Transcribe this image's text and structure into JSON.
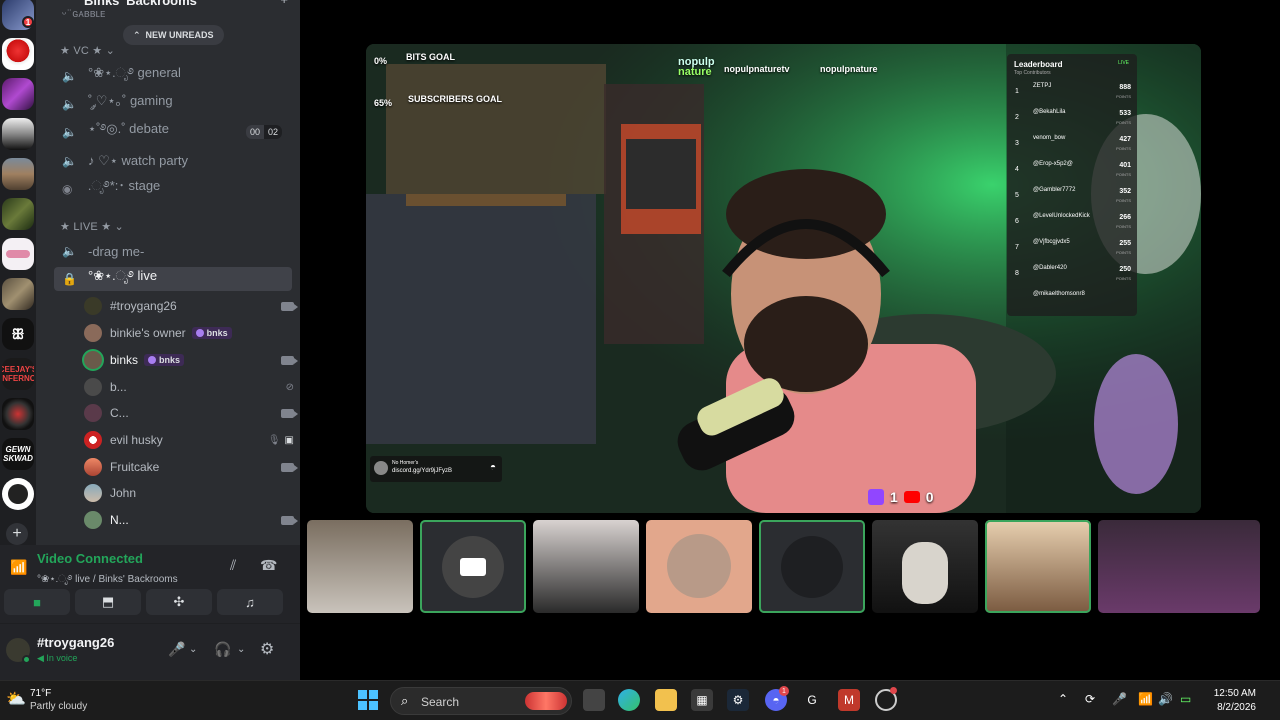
{
  "rail": {
    "badge_top": "1",
    "servers": [
      "DY",
      "",
      "",
      "",
      "",
      "",
      "",
      "",
      "",
      "",
      "CEEJAY'S INFERNO",
      "",
      "GEWN SKWAD",
      "",
      ""
    ]
  },
  "sidebar": {
    "server_name": "Binks' Backrooms",
    "partial_channel": "ᵕ ̈ ɢᴀʙʙʟᴇ",
    "new_unreads": "NEW UNREADS",
    "categories": {
      "vc": "★ VC ★",
      "live": "★ LIVE ★"
    },
    "channels": [
      {
        "name": "°❀⋆.ೃ࿔ general",
        "icon": "speaker-icon"
      },
      {
        "name": "˚ ༘♡⋆｡˚ gaming",
        "icon": "speaker-icon"
      },
      {
        "name": "⋆˚࿔◎.˚ debate",
        "icon": "speaker-icon",
        "count_a": "00",
        "count_b": "02"
      },
      {
        "name": "♪ ♡⋆ watch party",
        "icon": "speaker-icon"
      },
      {
        "name": ".ೃ࿔*:･ stage",
        "icon": "stage-icon"
      },
      {
        "name": "-drag me-",
        "icon": "speaker-icon"
      },
      {
        "name": "°❀⋆.ೃ࿔ live",
        "icon": "lock-speaker-icon"
      }
    ],
    "voice_users": [
      {
        "name": "#troygang26",
        "tag": "",
        "camera": true
      },
      {
        "name": "binkie's owner",
        "tag": "bnks",
        "camera": false
      },
      {
        "name": "binks",
        "tag": "bnks",
        "camera": true
      },
      {
        "name": "b...",
        "tag": "",
        "camera": false
      },
      {
        "name": "C...",
        "tag": "",
        "camera": true
      },
      {
        "name": "evil husky",
        "tag": "",
        "camera": false
      },
      {
        "name": "Fruitcake",
        "tag": "",
        "camera": true
      },
      {
        "name": "John",
        "tag": "",
        "camera": false
      },
      {
        "name": "N...",
        "tag": "",
        "camera": true
      }
    ]
  },
  "voice": {
    "status": "Video Connected",
    "location": "°❀⋆.ೃ࿔ live / Binks' Backrooms"
  },
  "user": {
    "name": "#troygang26",
    "status": "In voice"
  },
  "stream": {
    "bits_goal_pct": "0%",
    "bits_goal": "BITS GOAL",
    "sub_goal_pct": "65%",
    "sub_goal": "SUBSCRIBERS GOAL",
    "handle_1": "nopulpnaturetv",
    "handle_2": "nopulpnature",
    "logo_line_1": "nopulp",
    "logo_line_2": "nature",
    "discord_name": "No Homer's",
    "discord_link": "discord.gg/Ydr9jJFyzB",
    "twitch_count": "1",
    "youtube_count": "0",
    "leaderboard": {
      "title": "Leaderboard",
      "subtitle": "Top Contributors",
      "live": "LIVE",
      "rows": [
        {
          "rank": "1",
          "name": "ZETPJ",
          "points": "888"
        },
        {
          "rank": "2",
          "name": "@BekahLila",
          "points": "533"
        },
        {
          "rank": "3",
          "name": "venom_bow",
          "points": "427"
        },
        {
          "rank": "4",
          "name": "@Erop-x5p2@",
          "points": "401"
        },
        {
          "rank": "5",
          "name": "@Gambler7772",
          "points": "352"
        },
        {
          "rank": "6",
          "name": "@LevelUnlockedKick",
          "points": "266"
        },
        {
          "rank": "7",
          "name": "@Vjfbcgjvdx5",
          "points": "255"
        },
        {
          "rank": "8",
          "name": "@Dabler420",
          "points": "250"
        },
        {
          "rank": "",
          "name": "@mikaelthomsonr8",
          "points": ""
        }
      ],
      "points_label": "POINTS"
    }
  },
  "taskbar": {
    "temperature": "71°F",
    "condition": "Partly cloudy",
    "search": "Search",
    "discord_badge": "1",
    "time": "12:50 AM",
    "date": "8/2/2026"
  }
}
